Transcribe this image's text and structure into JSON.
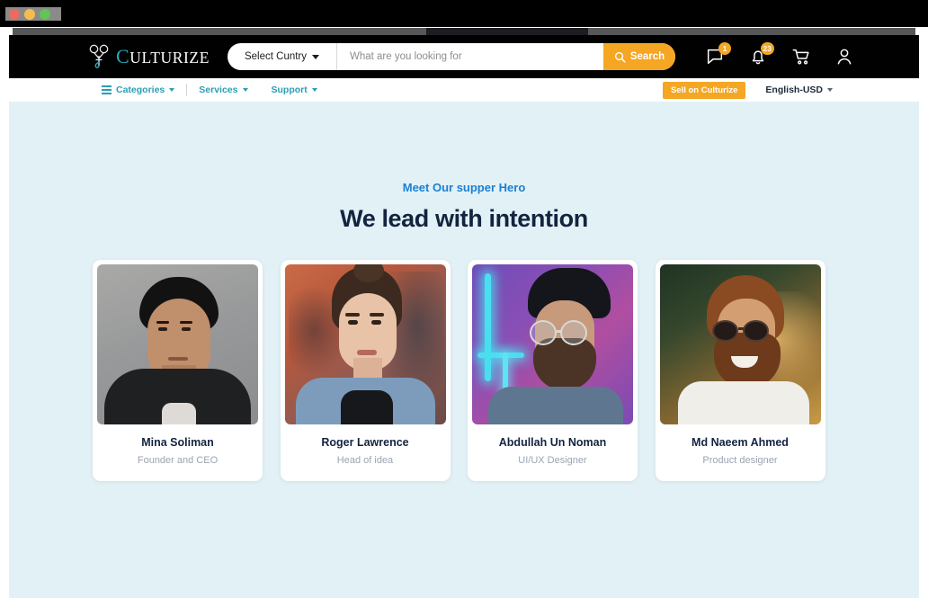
{
  "browser": {
    "traffic_lights": [
      "close",
      "minimize",
      "maximize"
    ]
  },
  "header": {
    "brand": {
      "initial": "C",
      "rest": "ULTURIZE",
      "icon": "culturize-scissors-logo"
    },
    "search": {
      "country_label": "Select Cuntry",
      "placeholder": "What are you looking for",
      "value": "",
      "button_label": "Search",
      "button_icon": "search-icon",
      "button_color": "#f5a623"
    },
    "icons": [
      {
        "name": "message-icon",
        "badge": "1"
      },
      {
        "name": "bell-icon",
        "badge": "23"
      },
      {
        "name": "cart-icon",
        "badge": ""
      },
      {
        "name": "user-icon",
        "badge": ""
      }
    ]
  },
  "subnav": {
    "items": [
      {
        "label": "Categories",
        "icon": "list-icon",
        "has_caret": true
      },
      {
        "label": "Services",
        "icon": "",
        "has_caret": true
      },
      {
        "label": "Support",
        "icon": "",
        "has_caret": true
      }
    ],
    "sell_label": "Sell on Culturize",
    "language_label": "English-USD",
    "link_color": "#2a9fb5"
  },
  "hero": {
    "eyebrow": "Meet Our supper Hero",
    "title": "We lead with intention",
    "eyebrow_color": "#1b7fd4",
    "title_color": "#132440",
    "background_color": "#e2f1f5"
  },
  "team": [
    {
      "name": "Mina Soliman",
      "role": "Founder and CEO",
      "photo": "portrait-gray-studio"
    },
    {
      "name": "Roger Lawrence",
      "role": "Head of idea",
      "photo": "portrait-rust-wall"
    },
    {
      "name": "Abdullah Un Noman",
      "role": "UI/UX Designer",
      "photo": "portrait-neon-purple"
    },
    {
      "name": "Md Naeem Ahmed",
      "role": "Product designer",
      "photo": "portrait-golden-sunset"
    }
  ]
}
